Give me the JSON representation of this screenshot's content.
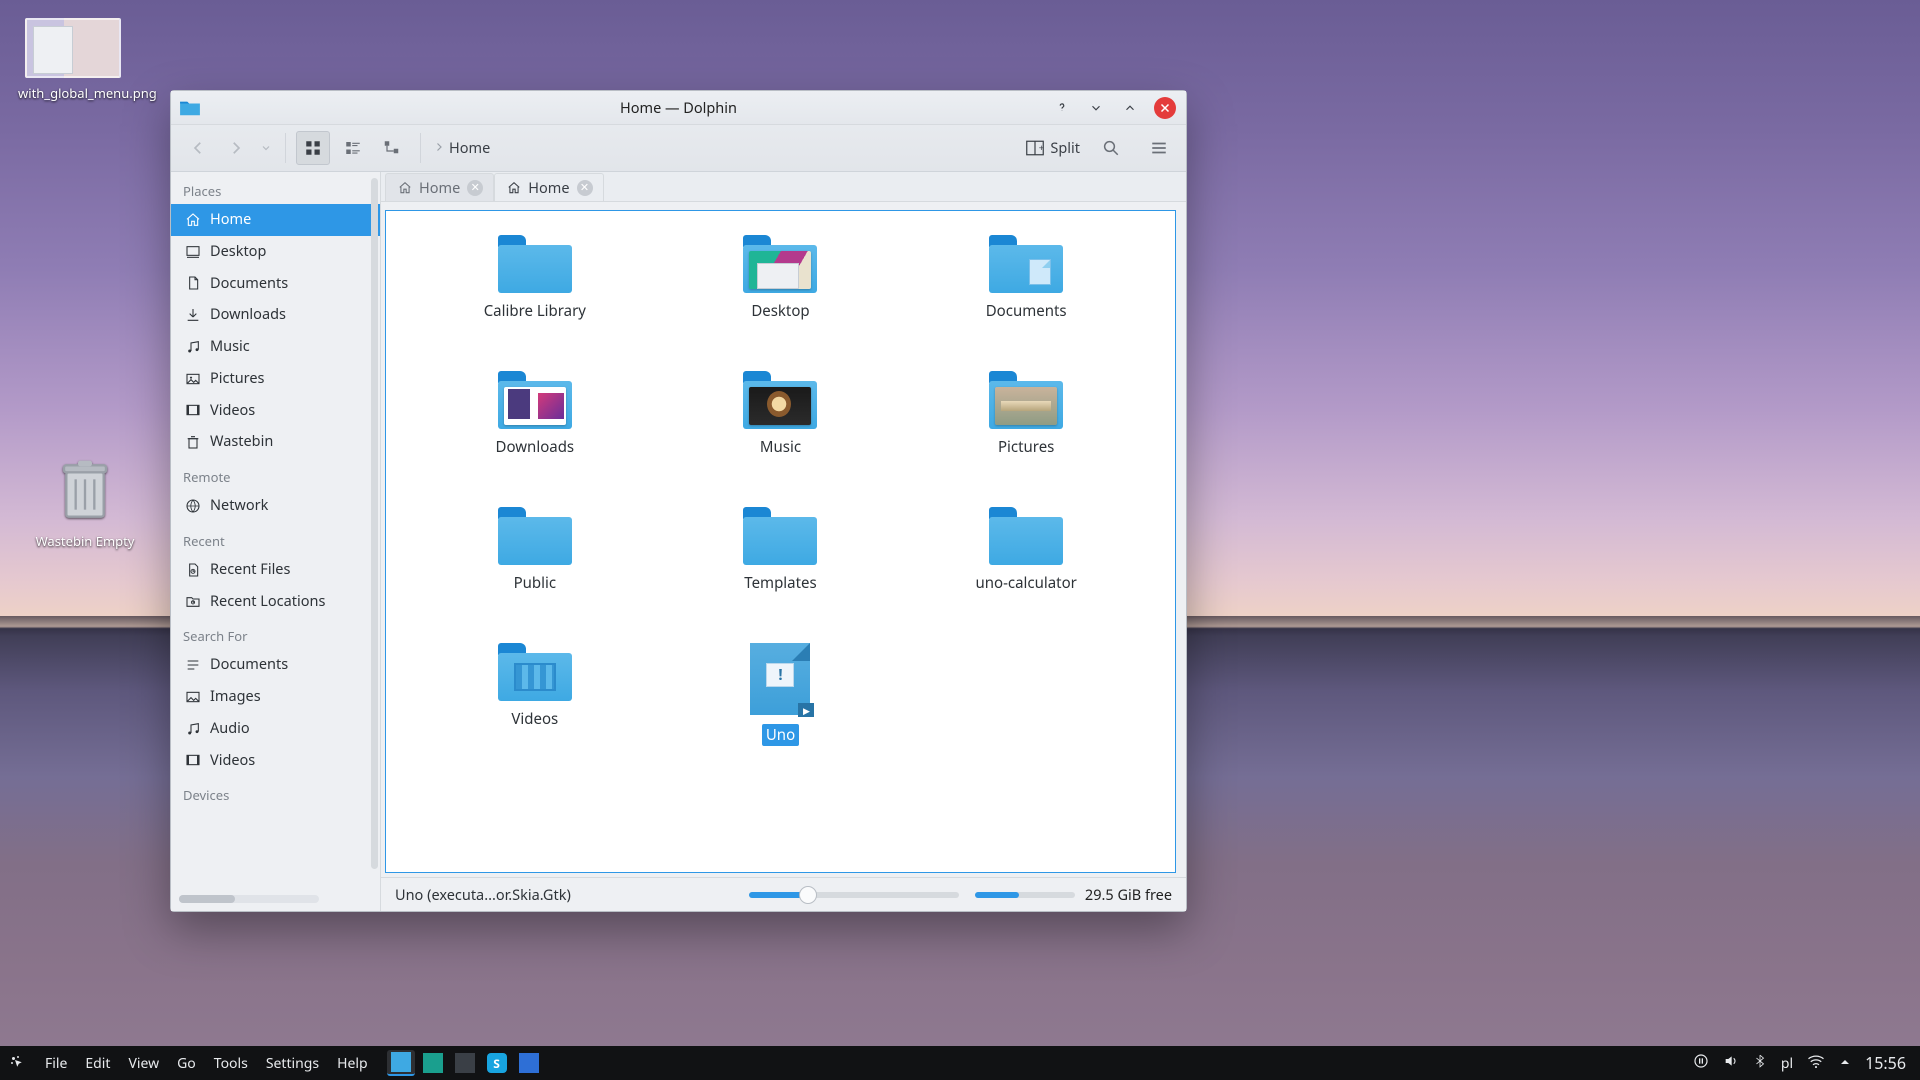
{
  "desktop": {
    "icons": [
      {
        "name": "with_global_menu.png"
      },
      {
        "name": "Wastebin Empty"
      }
    ]
  },
  "window": {
    "title": "Home — Dolphin",
    "toolbar": {
      "breadcrumb": "Home",
      "split_label": "Split"
    },
    "tabs": [
      {
        "label": "Home",
        "active": false
      },
      {
        "label": "Home",
        "active": true
      }
    ]
  },
  "sidebar": {
    "sections": [
      {
        "heading": "Places",
        "items": [
          {
            "label": "Home",
            "icon": "home",
            "active": true
          },
          {
            "label": "Desktop",
            "icon": "desktop"
          },
          {
            "label": "Documents",
            "icon": "documents"
          },
          {
            "label": "Downloads",
            "icon": "downloads"
          },
          {
            "label": "Music",
            "icon": "music"
          },
          {
            "label": "Pictures",
            "icon": "pictures"
          },
          {
            "label": "Videos",
            "icon": "videos"
          },
          {
            "label": "Wastebin",
            "icon": "trash"
          }
        ]
      },
      {
        "heading": "Remote",
        "items": [
          {
            "label": "Network",
            "icon": "network"
          }
        ]
      },
      {
        "heading": "Recent",
        "items": [
          {
            "label": "Recent Files",
            "icon": "recent-files"
          },
          {
            "label": "Recent Locations",
            "icon": "recent-locations"
          }
        ]
      },
      {
        "heading": "Search For",
        "items": [
          {
            "label": "Documents",
            "icon": "search-docs"
          },
          {
            "label": "Images",
            "icon": "search-images"
          },
          {
            "label": "Audio",
            "icon": "search-audio"
          },
          {
            "label": "Videos",
            "icon": "search-videos"
          }
        ]
      },
      {
        "heading": "Devices",
        "items": []
      }
    ]
  },
  "files": [
    {
      "name": "Calibre Library",
      "kind": "folder"
    },
    {
      "name": "Desktop",
      "kind": "folder-preview",
      "thumb": "desktop"
    },
    {
      "name": "Documents",
      "kind": "folder-note"
    },
    {
      "name": "Downloads",
      "kind": "folder-preview",
      "thumb": "downloads"
    },
    {
      "name": "Music",
      "kind": "folder-preview",
      "thumb": "music"
    },
    {
      "name": "Pictures",
      "kind": "folder-preview",
      "thumb": "pictures"
    },
    {
      "name": "Public",
      "kind": "folder"
    },
    {
      "name": "Templates",
      "kind": "folder"
    },
    {
      "name": "uno-calculator",
      "kind": "folder"
    },
    {
      "name": "Videos",
      "kind": "folder-videos"
    },
    {
      "name": "Uno",
      "kind": "shortcut",
      "selected": true
    }
  ],
  "status": {
    "selection": "Uno (executa...or.Skia.Gtk)",
    "free_space": "29.5 GiB free"
  },
  "panel": {
    "menu": [
      "File",
      "Edit",
      "View",
      "Go",
      "Tools",
      "Settings",
      "Help"
    ],
    "tasks": [
      {
        "name": "dolphin",
        "color": "#3ea9e3",
        "active": true
      },
      {
        "name": "edge",
        "color": "#1a9f8e"
      },
      {
        "name": "terminal",
        "color": "#3a3f46"
      },
      {
        "name": "skype",
        "color": "#18a4e0",
        "rounded": true,
        "badge": "S"
      },
      {
        "name": "app",
        "color": "#2e6fd6"
      }
    ],
    "tray": {
      "lang": "pl",
      "clock": "15:56"
    }
  }
}
